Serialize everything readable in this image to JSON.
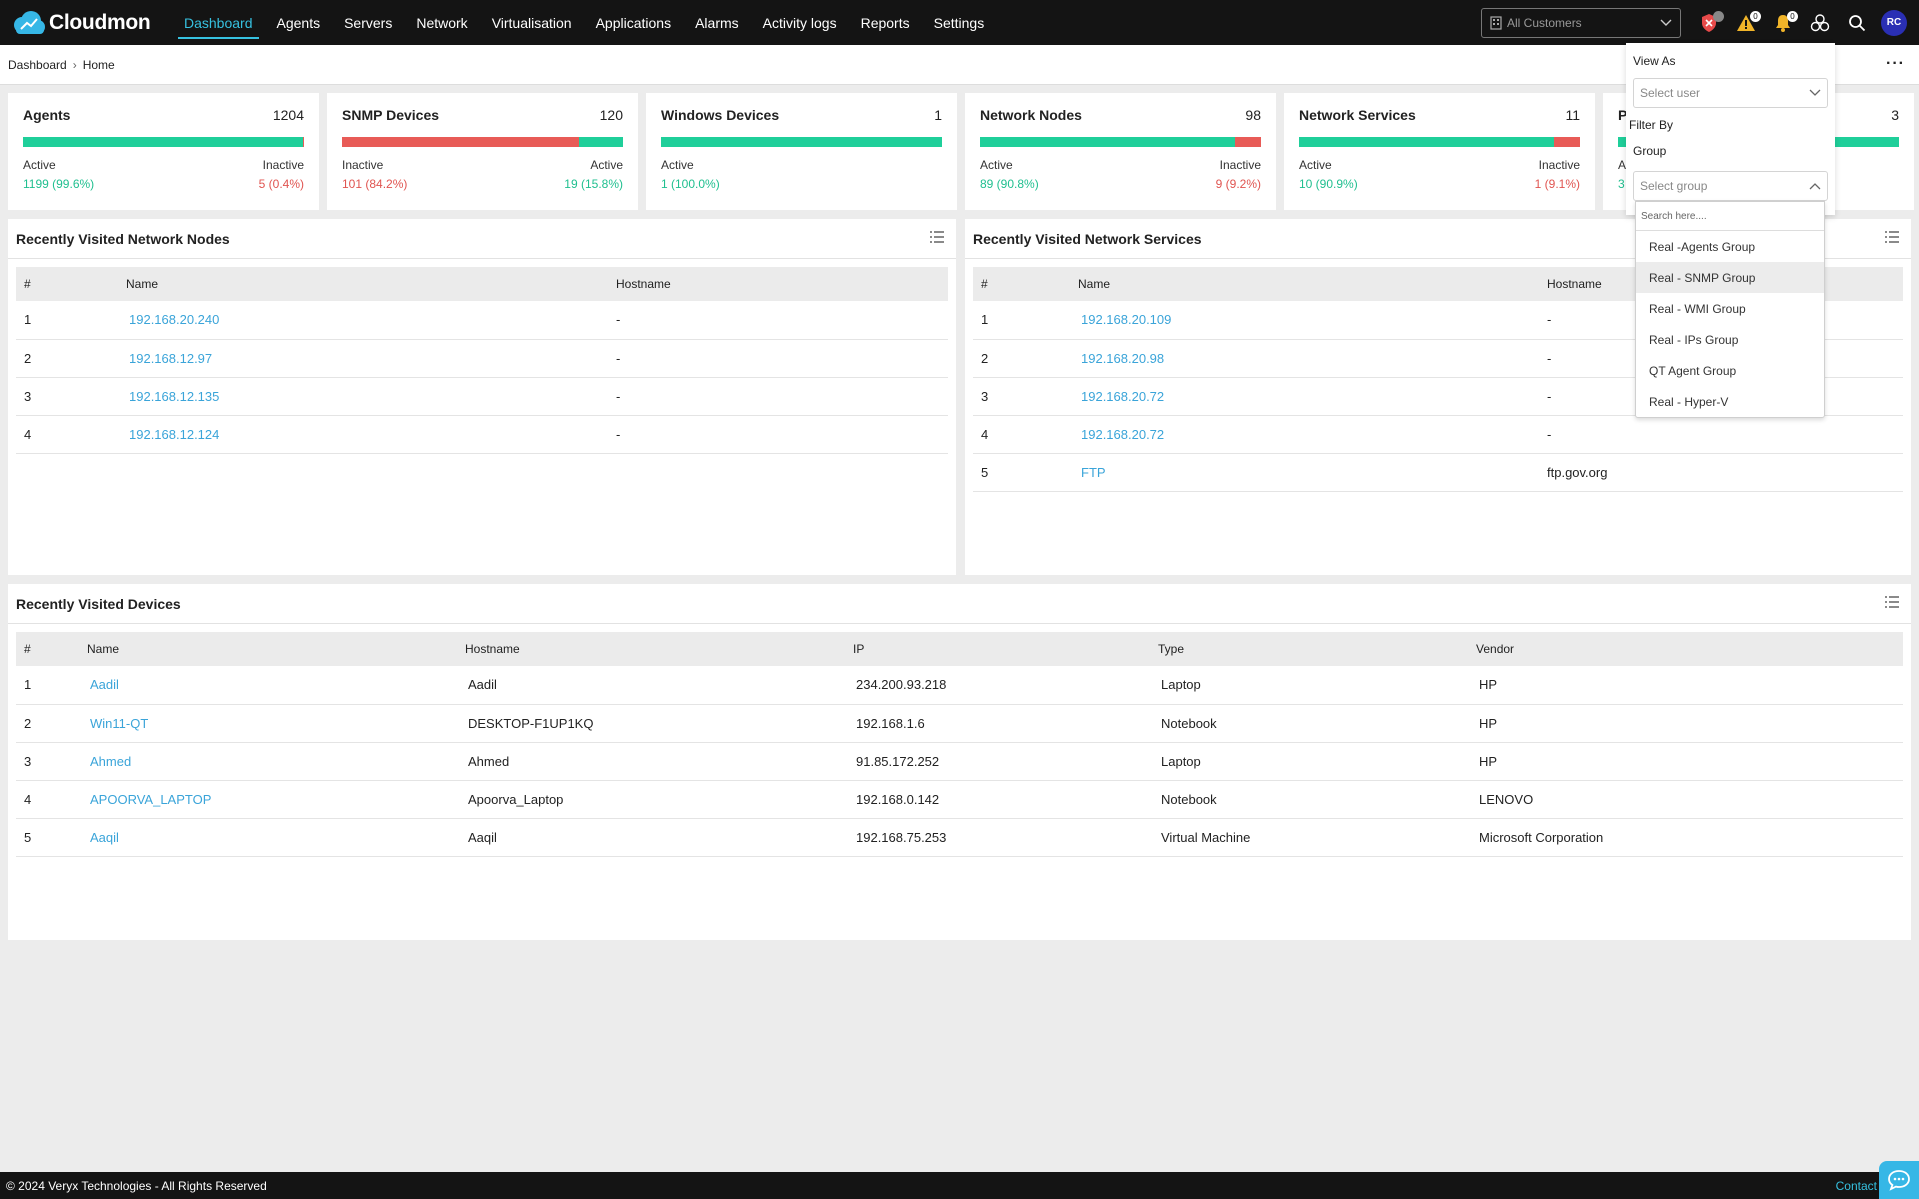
{
  "app": {
    "name": "Cloudmon"
  },
  "nav": [
    {
      "label": "Dashboard",
      "active": true
    },
    {
      "label": "Agents"
    },
    {
      "label": "Servers"
    },
    {
      "label": "Network"
    },
    {
      "label": "Virtualisation"
    },
    {
      "label": "Applications"
    },
    {
      "label": "Alarms"
    },
    {
      "label": "Activity logs"
    },
    {
      "label": "Reports"
    },
    {
      "label": "Settings"
    }
  ],
  "customer_select": {
    "value": "All Customers"
  },
  "top_icons": {
    "shield_badge": "1",
    "warning_badge": "0",
    "bell_badge": "0",
    "avatar_initials": "RC"
  },
  "breadcrumb": {
    "root": "Dashboard",
    "current": "Home"
  },
  "cards": [
    {
      "title": "Agents",
      "total": "1204",
      "left_label": "Active",
      "left_value": "1199 (99.6%)",
      "right_label": "Inactive",
      "right_value": "5 (0.4%)",
      "fill_pct": 99.6,
      "first": "green"
    },
    {
      "title": "SNMP Devices",
      "total": "120",
      "left_label": "Inactive",
      "left_value": "101 (84.2%)",
      "right_label": "Active",
      "right_value": "19 (15.8%)",
      "fill_pct": 84.2,
      "first": "red"
    },
    {
      "title": "Windows Devices",
      "total": "1",
      "left_label": "Active",
      "left_value": "1 (100.0%)",
      "right_label": "",
      "right_value": "",
      "fill_pct": 100,
      "first": "green"
    },
    {
      "title": "Network Nodes",
      "total": "98",
      "left_label": "Active",
      "left_value": "89 (90.8%)",
      "right_label": "Inactive",
      "right_value": "9 (9.2%)",
      "fill_pct": 90.8,
      "first": "green"
    },
    {
      "title": "Network Services",
      "total": "11",
      "left_label": "Active",
      "left_value": "10 (90.9%)",
      "right_label": "Inactive",
      "right_value": "1 (9.1%)",
      "fill_pct": 90.9,
      "first": "green"
    },
    {
      "title": "P",
      "total": "3",
      "left_label": "A",
      "left_value": "3",
      "right_label": "",
      "right_value": "",
      "fill_pct": 100,
      "first": "green"
    }
  ],
  "nodes_panel": {
    "title": "Recently Visited Network Nodes",
    "columns": [
      "#",
      "Name",
      "Hostname"
    ],
    "rows": [
      [
        "1",
        "192.168.20.240",
        "-"
      ],
      [
        "2",
        "192.168.12.97",
        "-"
      ],
      [
        "3",
        "192.168.12.135",
        "-"
      ],
      [
        "4",
        "192.168.12.124",
        "-"
      ]
    ]
  },
  "services_panel": {
    "title": "Recently Visited Network Services",
    "columns": [
      "#",
      "Name",
      "Hostname"
    ],
    "rows": [
      [
        "1",
        "192.168.20.109",
        "-"
      ],
      [
        "2",
        "192.168.20.98",
        "-"
      ],
      [
        "3",
        "192.168.20.72",
        "-"
      ],
      [
        "4",
        "192.168.20.72",
        "-"
      ],
      [
        "5",
        "FTP",
        "ftp.gov.org"
      ]
    ]
  },
  "devices_panel": {
    "title": "Recently Visited Devices",
    "columns": [
      "#",
      "Name",
      "Hostname",
      "IP",
      "Type",
      "Vendor"
    ],
    "rows": [
      [
        "1",
        "Aadil",
        "Aadil",
        "234.200.93.218",
        "Laptop",
        "HP"
      ],
      [
        "2",
        "Win11-QT",
        "DESKTOP-F1UP1KQ",
        "192.168.1.6",
        "Notebook",
        "HP"
      ],
      [
        "3",
        "Ahmed",
        "Ahmed",
        "91.85.172.252",
        "Laptop",
        "HP"
      ],
      [
        "4",
        "APOORVA_LAPTOP",
        "Apoorva_Laptop",
        "192.168.0.142",
        "Notebook",
        "LENOVO"
      ],
      [
        "5",
        "Aaqil",
        "Aaqil",
        "192.168.75.253",
        "Virtual Machine",
        "Microsoft Corporation"
      ]
    ]
  },
  "view_as": {
    "title": "View As",
    "user_placeholder": "Select user",
    "filter_by": "Filter By",
    "group_label": "Group",
    "group_placeholder": "Select group",
    "search_placeholder": "Search here....",
    "groups": [
      "Real -Agents Group",
      "Real - SNMP Group",
      "Real - WMI Group",
      "Real - IPs Group",
      "QT Agent Group",
      "Real - Hyper-V"
    ],
    "highlighted_index": 1
  },
  "footer": {
    "copyright": "© 2024 Veryx Technologies - All Rights Reserved",
    "contact": "Contact Su"
  },
  "colors": {
    "accent": "#36c1e0",
    "active": "#1fcf9a",
    "inactive": "#e85b57",
    "link": "#3aa4d9"
  }
}
